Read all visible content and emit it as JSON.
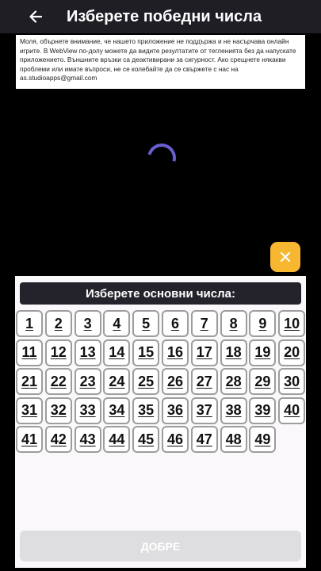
{
  "appbar": {
    "title": "Изберете победни числа",
    "back_icon": "arrow-left-icon"
  },
  "notice": {
    "text": "Моля, обърнете внимание, че нашето приложение не поддържа и не насърчава онлайн игрите. В WebView по-долу можете да видите резултатите от тегленията без да напускате приложението. Външните връзки са деактивирани за сигурност. Ако срещнете някакви проблеми или имате въпроси, не се колебайте да се свържете с нас на as.studioapps@gmail.com"
  },
  "loader": {
    "icon": "loading-spinner-icon"
  },
  "close_fab": {
    "icon": "close-icon",
    "color": "#f7b731"
  },
  "picker": {
    "header": "Изберете основни числа:",
    "numbers": [
      "1",
      "2",
      "3",
      "4",
      "5",
      "6",
      "7",
      "8",
      "9",
      "10",
      "11",
      "12",
      "13",
      "14",
      "15",
      "16",
      "17",
      "18",
      "19",
      "20",
      "21",
      "22",
      "23",
      "24",
      "25",
      "26",
      "27",
      "28",
      "29",
      "30",
      "31",
      "32",
      "33",
      "34",
      "35",
      "36",
      "37",
      "38",
      "39",
      "40",
      "41",
      "42",
      "43",
      "44",
      "45",
      "46",
      "47",
      "48",
      "49"
    ],
    "ok_label": "ДОБРЕ"
  },
  "colors": {
    "appbar_bg": "#201e25",
    "accent": "#f7b731",
    "spinner": "#6a5fd0",
    "disabled_button": "#dedde0"
  }
}
